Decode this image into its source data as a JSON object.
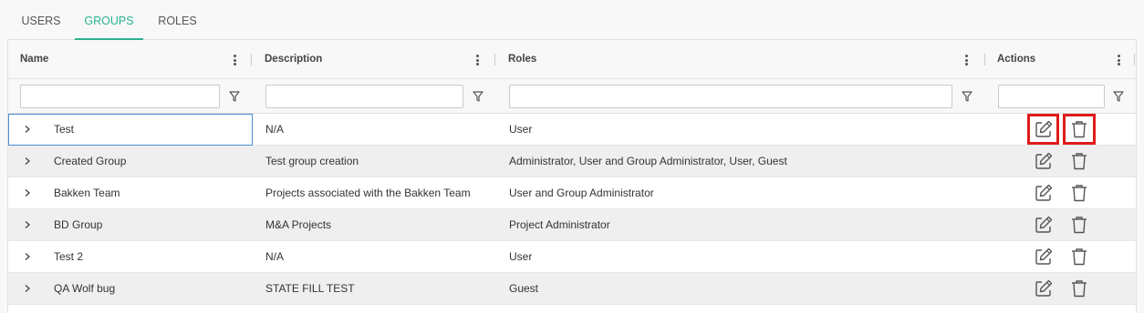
{
  "tabs": [
    {
      "label": "USERS",
      "active": false
    },
    {
      "label": "GROUPS",
      "active": true
    },
    {
      "label": "ROLES",
      "active": false
    }
  ],
  "accent_color": "#2bb38e",
  "highlight_color": "#e01b1b",
  "columns": [
    "Name",
    "Description",
    "Roles",
    "Actions"
  ],
  "filters": {
    "name": "",
    "description": "",
    "roles": "",
    "actions": ""
  },
  "rows": [
    {
      "name": "Test",
      "description": "N/A",
      "roles": "User"
    },
    {
      "name": "Created Group",
      "description": "Test group creation",
      "roles": "Administrator, User and Group Administrator, User, Guest"
    },
    {
      "name": "Bakken Team",
      "description": "Projects associated with the Bakken Team",
      "roles": "User and Group Administrator"
    },
    {
      "name": "BD Group",
      "description": "M&A Projects",
      "roles": "Project Administrator"
    },
    {
      "name": "Test 2",
      "description": "N/A",
      "roles": "User"
    },
    {
      "name": "QA Wolf bug",
      "description": "STATE FILL TEST",
      "roles": "Guest"
    }
  ],
  "icons": {
    "expand": "chevron-right-icon",
    "edit": "edit-icon",
    "delete": "trash-icon",
    "filter": "filter-icon",
    "menu": "kebab-menu-icon"
  }
}
